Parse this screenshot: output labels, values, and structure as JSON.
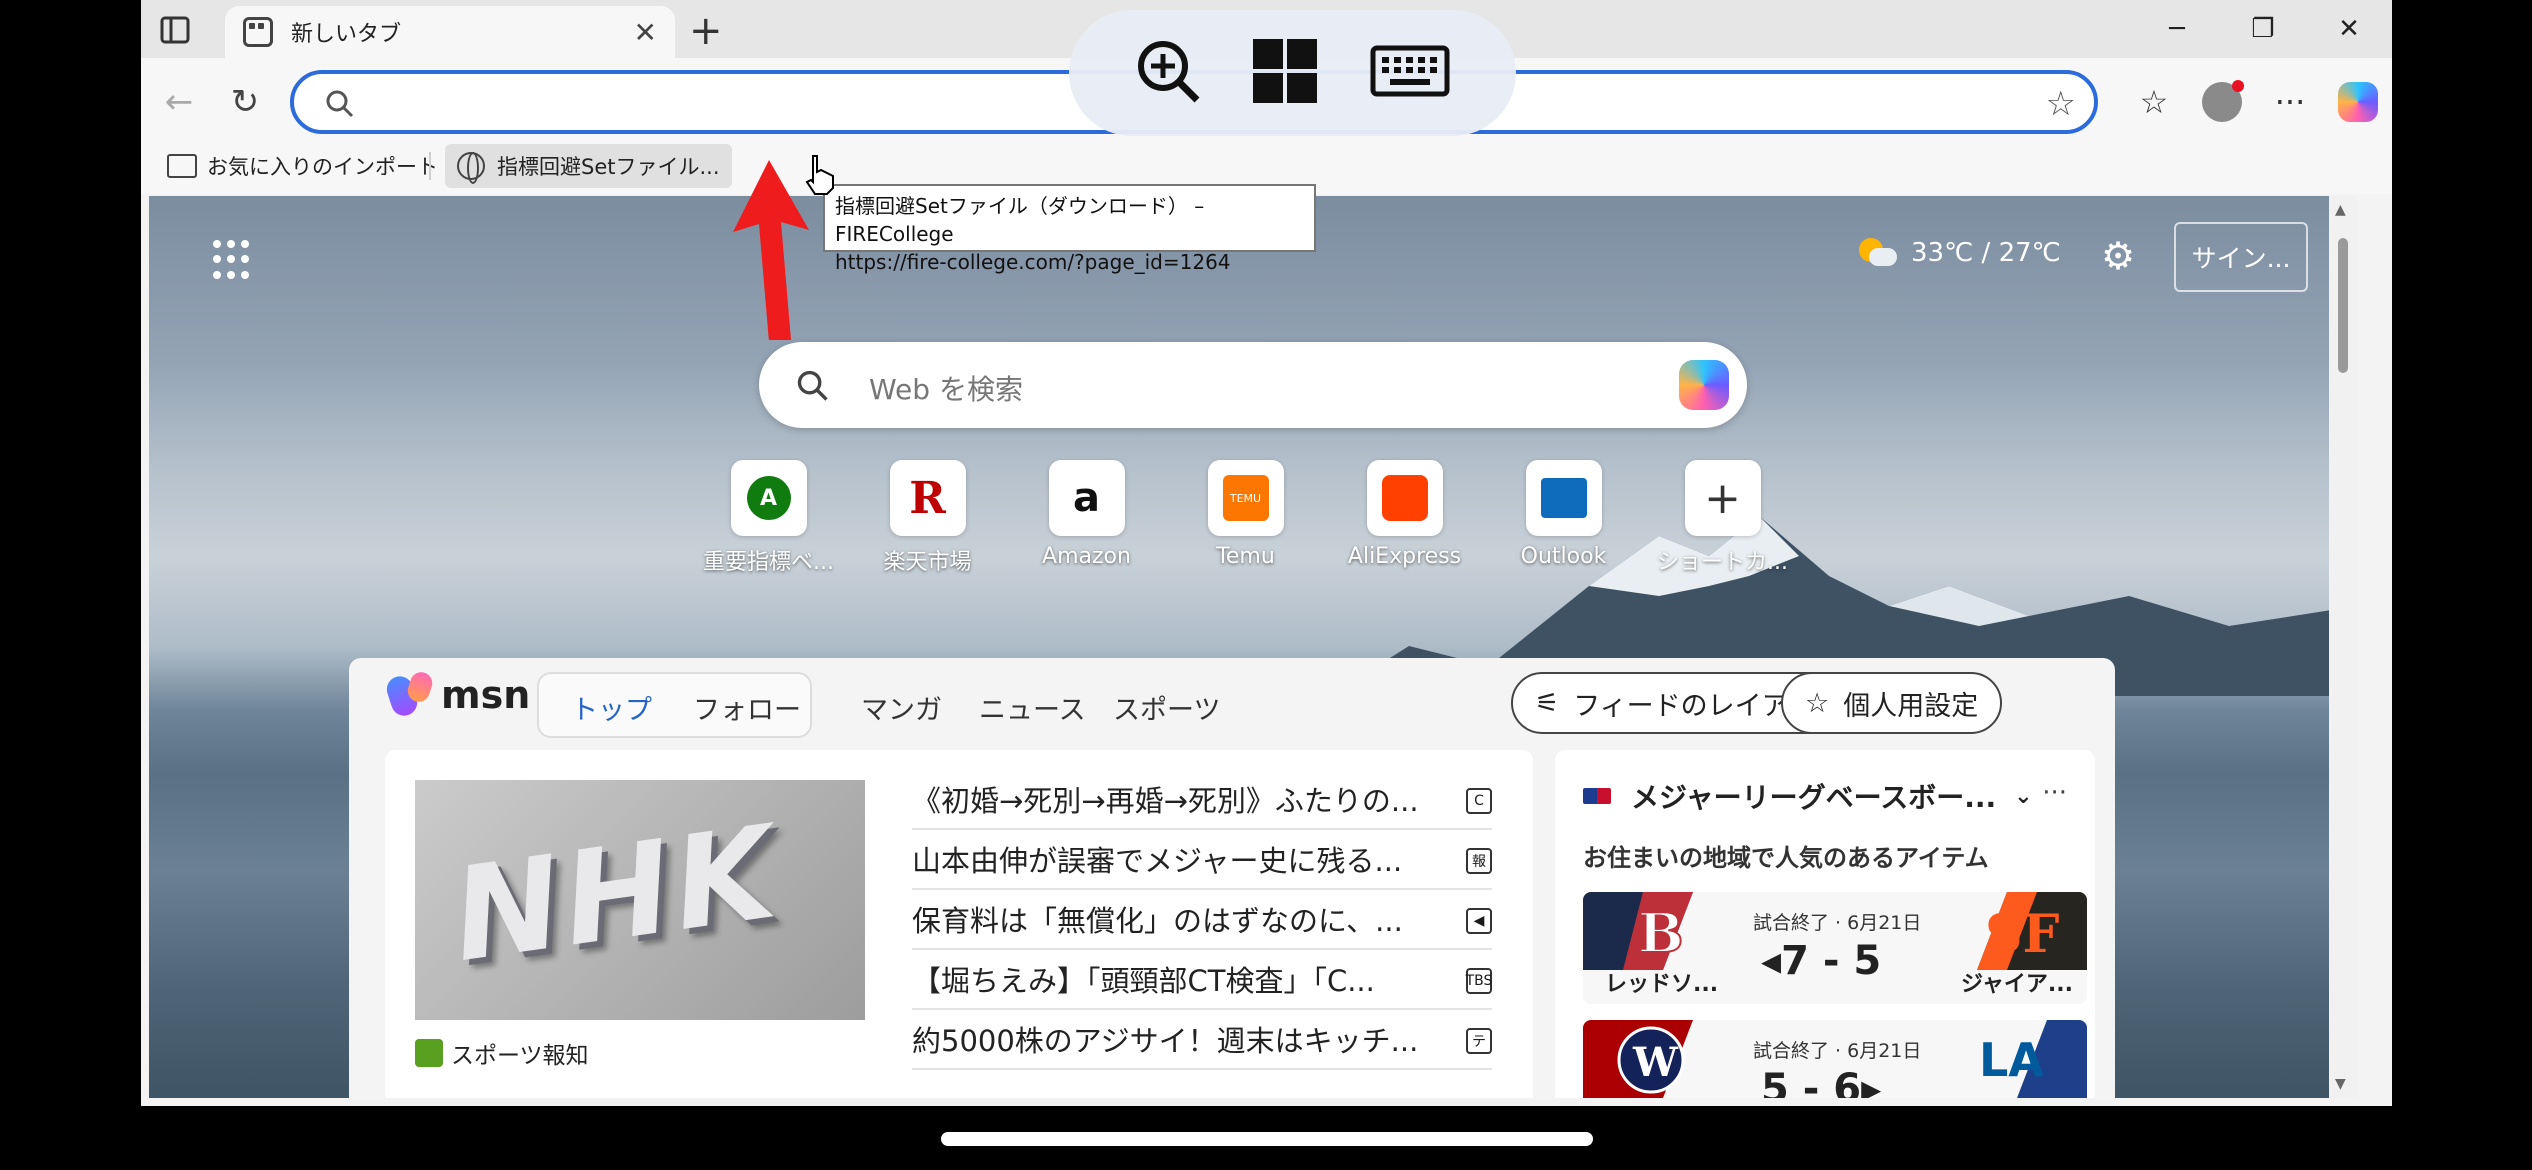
{
  "tab": {
    "title": "新しいタブ",
    "close": "✕",
    "new": "+"
  },
  "window_controls": [
    "─",
    "❐",
    "✕"
  ],
  "favorites": {
    "import_label": "お気に入りのインポート",
    "item_label": "指標回避Setファイル..."
  },
  "tooltip": {
    "line1": "指標回避Setファイル（ダウンロード） – FIRECollege",
    "line2": "https://fire-college.com/?page_id=1264"
  },
  "weather": {
    "temp": "33℃ / 27℃"
  },
  "signin_label": "サイン...",
  "search": {
    "placeholder": "Web を検索"
  },
  "quick_links": [
    {
      "label": "重要指標ベ...",
      "icon": "A"
    },
    {
      "label": "楽天市場",
      "icon": "R"
    },
    {
      "label": "Amazon",
      "icon": "a"
    },
    {
      "label": "Temu",
      "icon": "TEMU"
    },
    {
      "label": "AliExpress",
      "icon": ""
    },
    {
      "label": "Outlook",
      "icon": ""
    },
    {
      "label": "ショートカ...",
      "icon": "+"
    }
  ],
  "feed": {
    "logo": "msn",
    "tabs": [
      "トップ",
      "フォロー",
      "マンガ",
      "ニュース",
      "スポーツ"
    ],
    "more": "···",
    "layout_button": "フィードのレイアウト",
    "personal_button": "個人用設定",
    "lead_source": "スポーツ報知",
    "lead_image_text": "NHK",
    "headlines": [
      {
        "text": "《初婚→死別→再婚→死別》ふたりの...",
        "pub": "C"
      },
      {
        "text": "山本由伸が誤審でメジャー史に残る...",
        "pub": "報"
      },
      {
        "text": "保育料は「無償化」のはずなのに、...",
        "pub": "◀"
      },
      {
        "text": "【堀ちえみ】「頭頸部CT検査」「C...",
        "pub": "TBS"
      },
      {
        "text": "約5000株のアジサイ！週末はキッチ...",
        "pub": "テ"
      }
    ]
  },
  "sports": {
    "title": "メジャーリーグベースボー...",
    "subtitle": "お住まいの地域で人気のあるアイテム",
    "games": [
      {
        "status": "試合終了 · 6月21日",
        "score": "◂7 - 5",
        "left": "レッドソ...",
        "right": "ジャイア..."
      },
      {
        "status": "試合終了 · 6月21日",
        "score": "5 - 6▸",
        "left": "",
        "right": ""
      }
    ]
  },
  "colors": {
    "accent": "#2b6bdc",
    "tab_active": "#2463c7"
  }
}
